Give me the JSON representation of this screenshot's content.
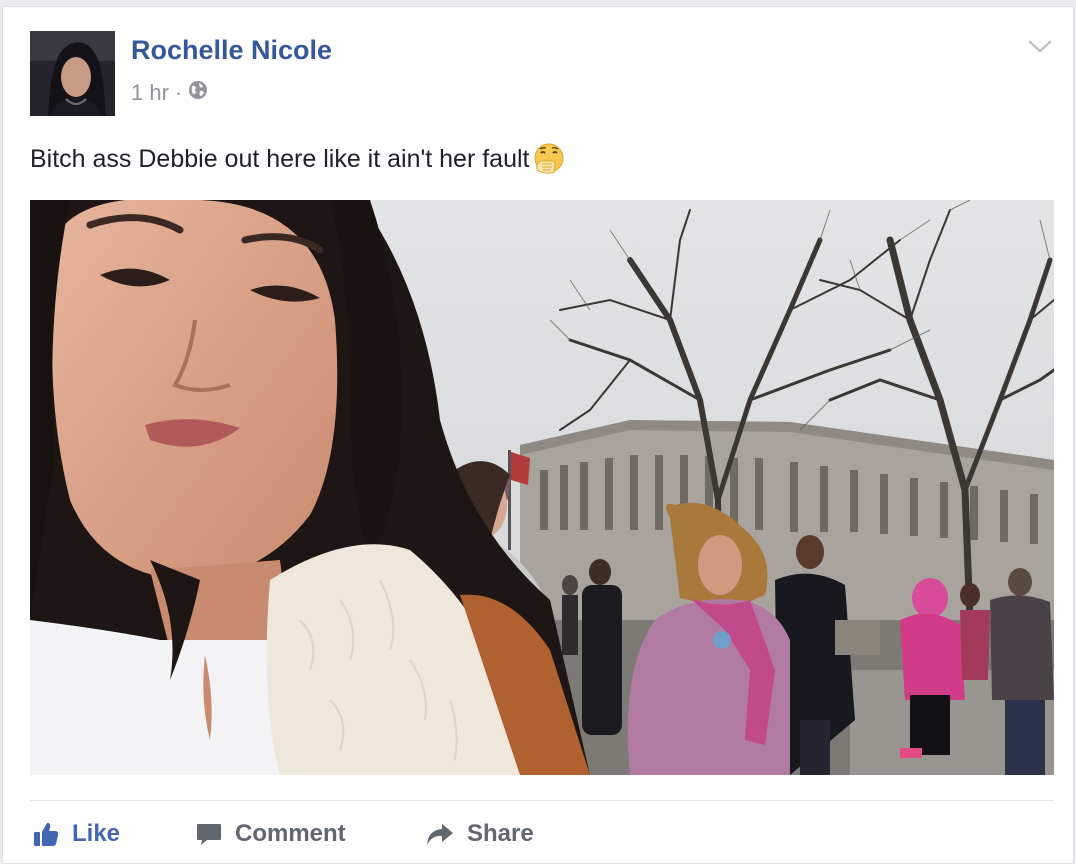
{
  "post": {
    "author": "Rochelle Nicole",
    "timestamp": "1 hr",
    "separator": "·",
    "privacy_icon": "globe-icon",
    "text": "Bitch ass Debbie out here like it ain't her fault",
    "emoji_icon": "face-with-hand-over-mouth-icon"
  },
  "actions": {
    "like_label": "Like",
    "comment_label": "Comment",
    "share_label": "Share"
  },
  "colors": {
    "link_blue": "#365899",
    "like_blue": "#4267b2",
    "meta_gray": "#90949c",
    "action_gray": "#616770"
  }
}
